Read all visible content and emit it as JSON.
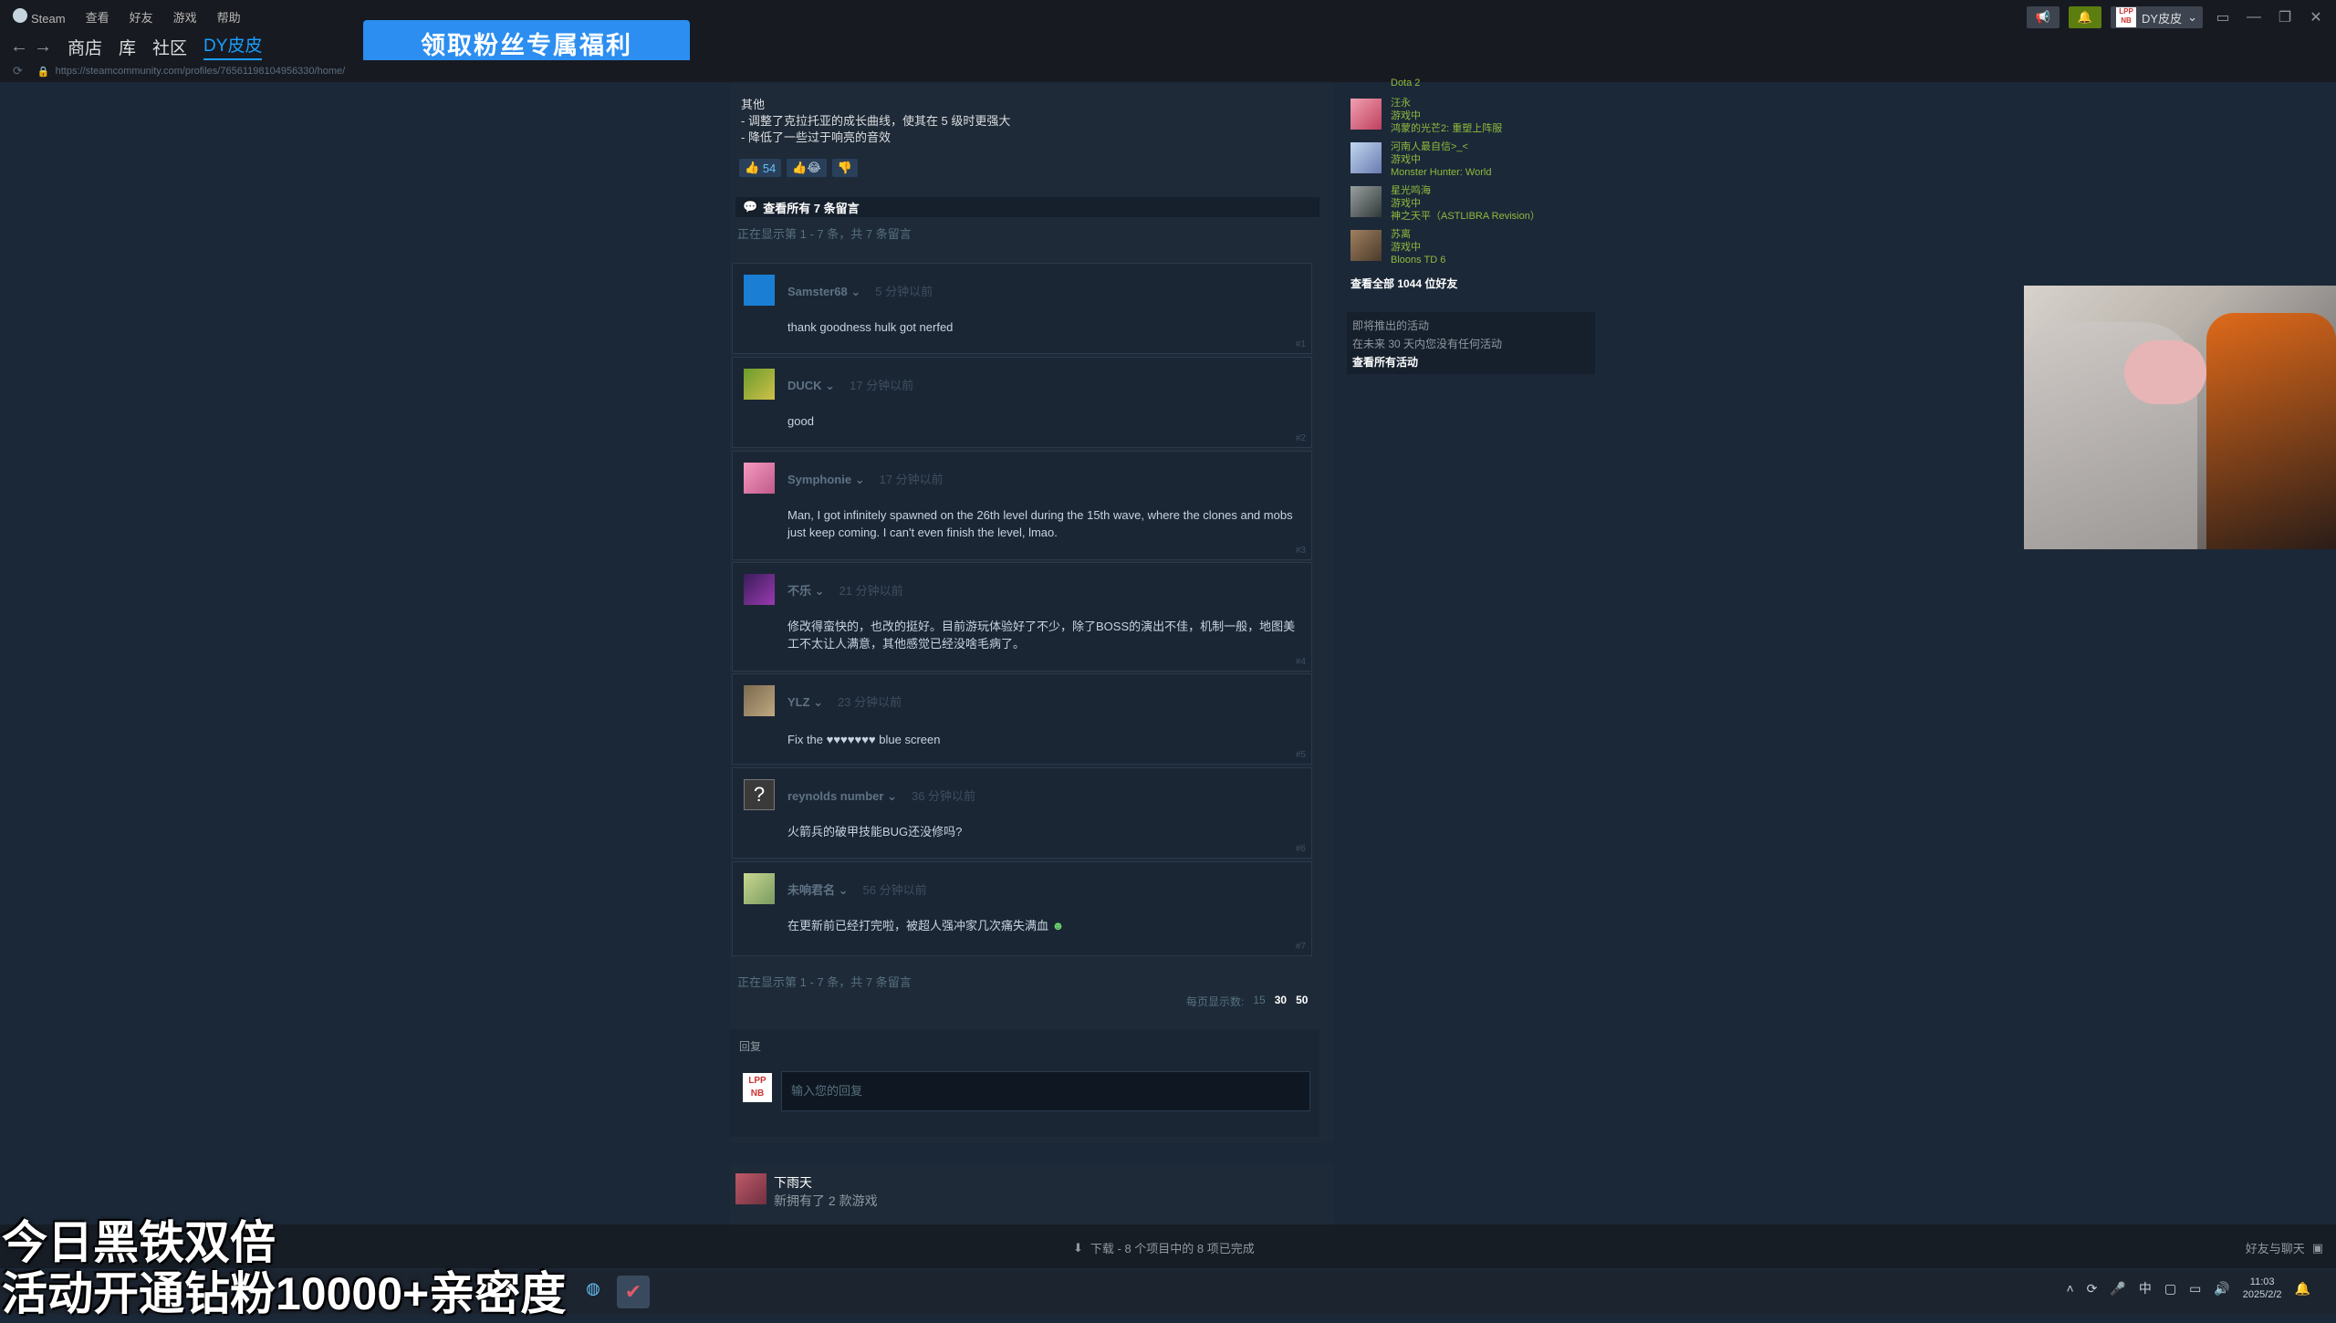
{
  "window": {
    "menu": [
      "Steam",
      "查看",
      "好友",
      "游戏",
      "帮助"
    ],
    "nav_tabs": [
      "商店",
      "库",
      "社区",
      "DY皮皮"
    ],
    "url": "https://steamcommunity.com/profiles/76561198104956330/home/",
    "promo_banner": "领取粉丝专属福利",
    "user_name": "DY皮皮",
    "user_avatar_text": "LPP NB"
  },
  "post": {
    "section": "其他",
    "lines": [
      "- 调整了克拉托亚的成长曲线，使其在 5 级时更强大",
      "- 降低了一些过于响亮的音效"
    ],
    "likes": "54"
  },
  "comments_header": "查看所有 7 条留言",
  "paging_text": "正在显示第 1 - 7 条，共 7 条留言",
  "comments": [
    {
      "name": "Samster68",
      "time": "5 分钟以前",
      "text": "thank goodness hulk got nerfed",
      "num": "#1"
    },
    {
      "name": "DUCK",
      "time": "17 分钟以前",
      "text": "good",
      "num": "#2"
    },
    {
      "name": "Symphonie",
      "time": "17 分钟以前",
      "text": "Man, I got infinitely spawned on the 26th level during the 15th wave, where the clones and mobs just keep coming. I can't even finish the level, lmao.",
      "num": "#3"
    },
    {
      "name": "不乐",
      "time": "21 分钟以前",
      "text": "修改得蛮快的，也改的挺好。目前游玩体验好了不少，除了BOSS的演出不佳，机制一般，地图美工不太让人满意，其他感觉已经没啥毛病了。",
      "num": "#4"
    },
    {
      "name": "YLZ",
      "time": "23 分钟以前",
      "text": "Fix the ♥♥♥♥♥♥♥ blue screen",
      "num": "#5"
    },
    {
      "name": "reynolds number",
      "time": "36 分钟以前",
      "text": "火箭兵的破甲技能BUG还没修吗?",
      "num": "#6"
    },
    {
      "name": "未响君名",
      "time": "56 分钟以前",
      "text": "在更新前已经打完啦，被超人强冲家几次痛失满血",
      "num": "#7"
    }
  ],
  "per_page": {
    "label": "每页显示数:",
    "options": [
      "15",
      "30",
      "50"
    ]
  },
  "reply": {
    "label": "回复",
    "placeholder": "输入您的回复"
  },
  "next_post": {
    "user": "下雨天",
    "text": "新拥有了 2 款游戏"
  },
  "friends": [
    {
      "name": "Dota 2",
      "status": "",
      "game": ""
    },
    {
      "name": "汪永",
      "status": "游戏中",
      "game": "鸿蒙的光芒2: 重塑上阵服"
    },
    {
      "name": "河南人最自信>_<",
      "status": "游戏中",
      "game": "Monster Hunter: World"
    },
    {
      "name": "星光鸣海",
      "status": "游戏中",
      "game": "神之天平（ASTLIBRA Revision）"
    },
    {
      "name": "苏离",
      "status": "游戏中",
      "game": "Bloons TD 6"
    }
  ],
  "friends_all": "查看全部 1044 位好友",
  "events": {
    "title": "即将推出的活动",
    "text": "在未来 30 天内您没有任何活动",
    "link": "查看所有活动"
  },
  "statusbar": {
    "download": "下载 - 8 个项目中的 8 项已完成",
    "friends_chat": "好友与聊天"
  },
  "overlay": {
    "line1": "今日黑铁双倍",
    "line2": "活动开通钻粉10000+亲密度"
  },
  "taskbar": {
    "time": "11:03",
    "date": "2025/2/2",
    "ime": "中"
  }
}
